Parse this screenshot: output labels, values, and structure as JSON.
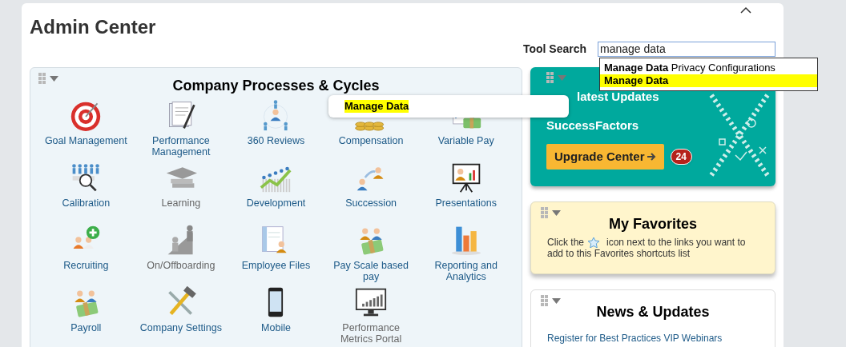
{
  "page": {
    "title": "Admin Center"
  },
  "tool_search": {
    "label": "Tool Search",
    "value": "manage data",
    "suggestions": [
      {
        "text": "**Manage Data** Privacy Configurations",
        "selected": false
      },
      {
        "text": "**Manage Data**",
        "selected": true
      }
    ]
  },
  "tooltip": {
    "text": "Manage Data"
  },
  "processes": {
    "title": "Company Processes & Cycles",
    "tiles": [
      {
        "label": "Goal Management",
        "disabled": false
      },
      {
        "label": "Performance Management",
        "disabled": false
      },
      {
        "label": "360 Reviews",
        "disabled": false
      },
      {
        "label": "Compensation",
        "disabled": false
      },
      {
        "label": "Variable Pay",
        "disabled": false
      },
      {
        "label": "Calibration",
        "disabled": false
      },
      {
        "label": "Learning",
        "disabled": true
      },
      {
        "label": "Development",
        "disabled": false
      },
      {
        "label": "Succession",
        "disabled": false
      },
      {
        "label": "Presentations",
        "disabled": false
      },
      {
        "label": "Recruiting",
        "disabled": false
      },
      {
        "label": "On/Offboarding",
        "disabled": true
      },
      {
        "label": "Employee Files",
        "disabled": false
      },
      {
        "label": "Pay Scale based pay",
        "disabled": false
      },
      {
        "label": "Reporting and Analytics",
        "disabled": false
      },
      {
        "label": "Payroll",
        "disabled": false
      },
      {
        "label": "Company Settings",
        "disabled": false
      },
      {
        "label": "Mobile",
        "disabled": false
      },
      {
        "label": "Performance Metrics Portal",
        "disabled": true
      }
    ]
  },
  "updates_card": {
    "heading": "latest Updates",
    "brand": "SuccessFactors",
    "button": "Upgrade Center",
    "badge": "24"
  },
  "favorites": {
    "title": "My Favorites",
    "text_before": "Click the",
    "text_after": "icon next to the links you want to",
    "text_line_2": "add to this Favorites shortcuts list"
  },
  "news": {
    "title": "News & Updates",
    "links": [
      "Register for Best Practices VIP Webinars"
    ]
  }
}
